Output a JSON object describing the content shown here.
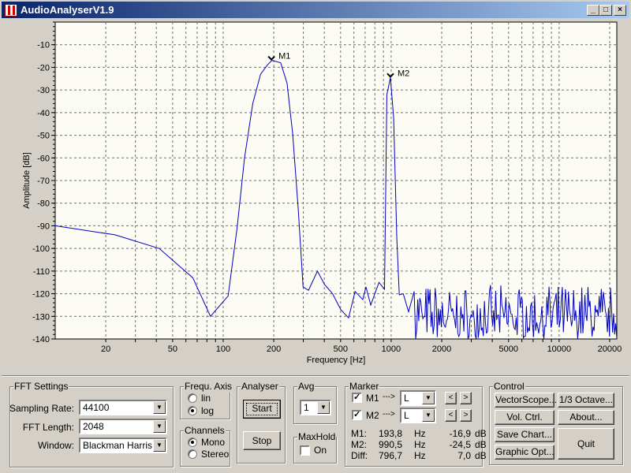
{
  "window": {
    "title": "AudioAnalyserV1.9",
    "minimize": "_",
    "maximize": "□",
    "close": "×"
  },
  "chart_data": {
    "type": "line",
    "xlabel": "Frequency [Hz]",
    "ylabel": "Amplitude [dB]",
    "x_scale": "log",
    "xlim": [
      10,
      22050
    ],
    "ylim": [
      -140,
      0
    ],
    "grid": true,
    "x_ticks": [
      {
        "v": 20,
        "label": "20"
      },
      {
        "v": 50,
        "label": "50"
      },
      {
        "v": 100,
        "label": "100"
      },
      {
        "v": 200,
        "label": "200"
      },
      {
        "v": 500,
        "label": "500"
      },
      {
        "v": 1000,
        "label": "1000"
      },
      {
        "v": 2000,
        "label": "2000"
      },
      {
        "v": 5000,
        "label": "5000"
      },
      {
        "v": 10000,
        "label": "10000"
      },
      {
        "v": 20000,
        "label": "20000"
      }
    ],
    "y_ticks": [
      "-10",
      "-20",
      "-30",
      "-40",
      "-50",
      "-60",
      "-70",
      "-80",
      "-90",
      "-100",
      "-110",
      "-120",
      "-130",
      "-140"
    ],
    "line_color": "#0000c0",
    "series": [
      {
        "x": [
          10,
          22.7,
          41.6,
          66,
          84,
          107,
          121,
          134,
          150,
          167,
          183,
          195,
          220,
          240,
          259,
          280,
          299,
          322,
          364,
          402,
          448,
          501,
          558,
          610,
          678,
          708,
          756,
          846,
          913,
          943,
          990,
          1035,
          1080,
          1118,
          1180,
          1270,
          1370
        ],
        "y": [
          -90,
          -94,
          -100,
          -113,
          -130,
          -121,
          -91,
          -60,
          -36,
          -23,
          -19,
          -16.9,
          -18,
          -27,
          -49,
          -83,
          -117,
          -118.5,
          -110,
          -116,
          -120,
          -127,
          -130.7,
          -119,
          -122.6,
          -117,
          -125,
          -115,
          -118,
          -32,
          -24.5,
          -42.5,
          -95,
          -120.5,
          -120,
          -128,
          -119
        ]
      }
    ],
    "noise_region": {
      "from_hz": 1400,
      "to_hz": 22050,
      "min_db": -140,
      "max_db": -116
    },
    "markers": [
      {
        "label": "M1",
        "x": 193.8,
        "y": -16.9
      },
      {
        "label": "M2",
        "x": 990.5,
        "y": -24.5
      }
    ]
  },
  "fft": {
    "title": "FFT Settings",
    "sampling_rate_label": "Sampling Rate:",
    "sampling_rate": "44100",
    "fft_length_label": "FFT Length:",
    "fft_length": "2048",
    "window_label": "Window:",
    "window": "Blackman Harris"
  },
  "freq_axis": {
    "title": "Frequ. Axis",
    "lin": "lin",
    "log": "log",
    "selected": "log"
  },
  "channels": {
    "title": "Channels",
    "mono": "Mono",
    "stereo": "Stereo",
    "selected": "Mono"
  },
  "analyser": {
    "title": "Analyser",
    "start": "Start",
    "stop": "Stop"
  },
  "avg": {
    "title": "Avg",
    "value": "1"
  },
  "maxhold": {
    "title": "MaxHold",
    "on": "On",
    "checked": false
  },
  "marker": {
    "title": "Marker",
    "arrow": "--->",
    "prev": "<",
    "next": ">",
    "m1": {
      "label": "M1",
      "checked": true,
      "channel": "L"
    },
    "m2": {
      "label": "M2",
      "checked": true,
      "channel": "L"
    },
    "rows": [
      {
        "name": "M1:",
        "freq": "193,8",
        "hz": "Hz",
        "db": "-16,9",
        "dbu": "dB"
      },
      {
        "name": "M2:",
        "freq": "990,5",
        "hz": "Hz",
        "db": "-24,5",
        "dbu": "dB"
      },
      {
        "name": "Diff:",
        "freq": "796,7",
        "hz": "Hz",
        "db": "7,0",
        "dbu": "dB"
      }
    ]
  },
  "control": {
    "title": "Control",
    "vectorscope": "VectorScope...",
    "octave": "1/3 Octave...",
    "volctrl": "Vol. Ctrl.",
    "about": "About...",
    "savechart": "Save Chart...",
    "graphicopt": "Graphic Opt...",
    "quit": "Quit"
  }
}
